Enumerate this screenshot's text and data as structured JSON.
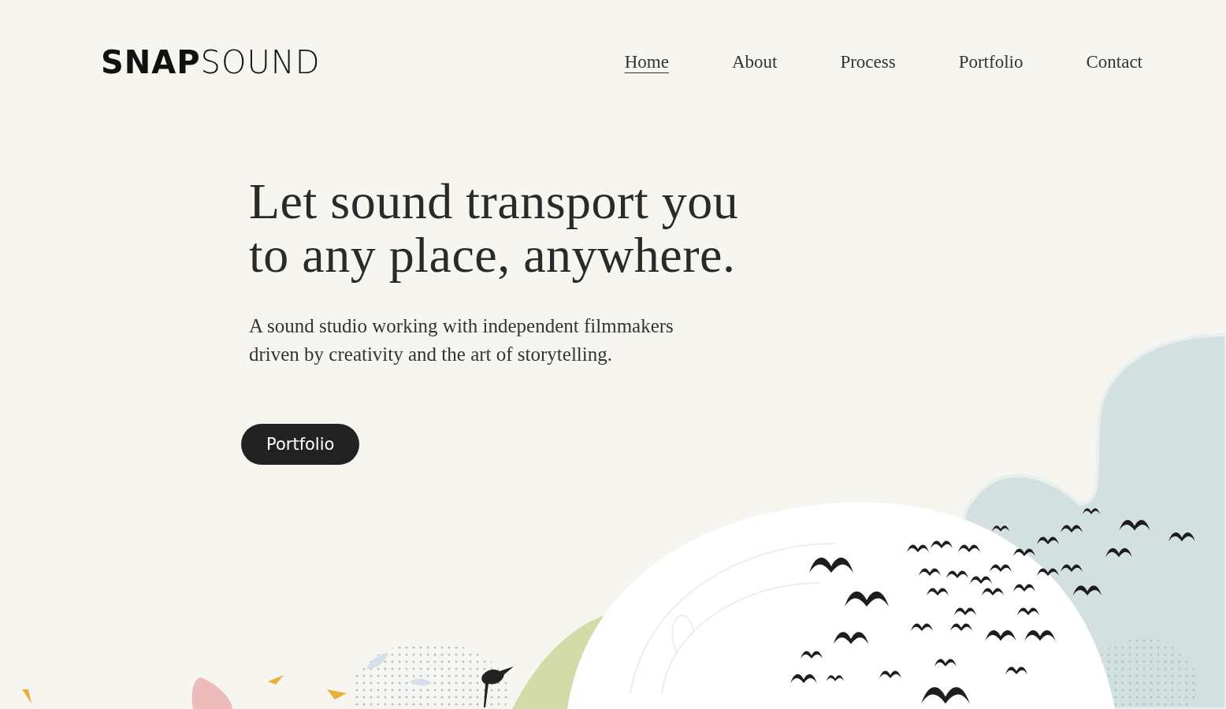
{
  "logo": "**SNAP**SOUND",
  "nav": [
    {
      "label": "Home",
      "selected": true
    },
    {
      "label": "About",
      "selected": false
    },
    {
      "label": "Process",
      "selected": false
    },
    {
      "label": "Portfolio",
      "selected": false
    },
    {
      "label": "Contact",
      "selected": false
    }
  ],
  "hero": {
    "heading": [
      "Let sound transport you",
      "to any place, anywhere."
    ],
    "description": [
      "A sound studio working with independent filmmakers",
      "driven by creativity and the art of storytelling."
    ],
    "button": "Portfolio"
  }
}
